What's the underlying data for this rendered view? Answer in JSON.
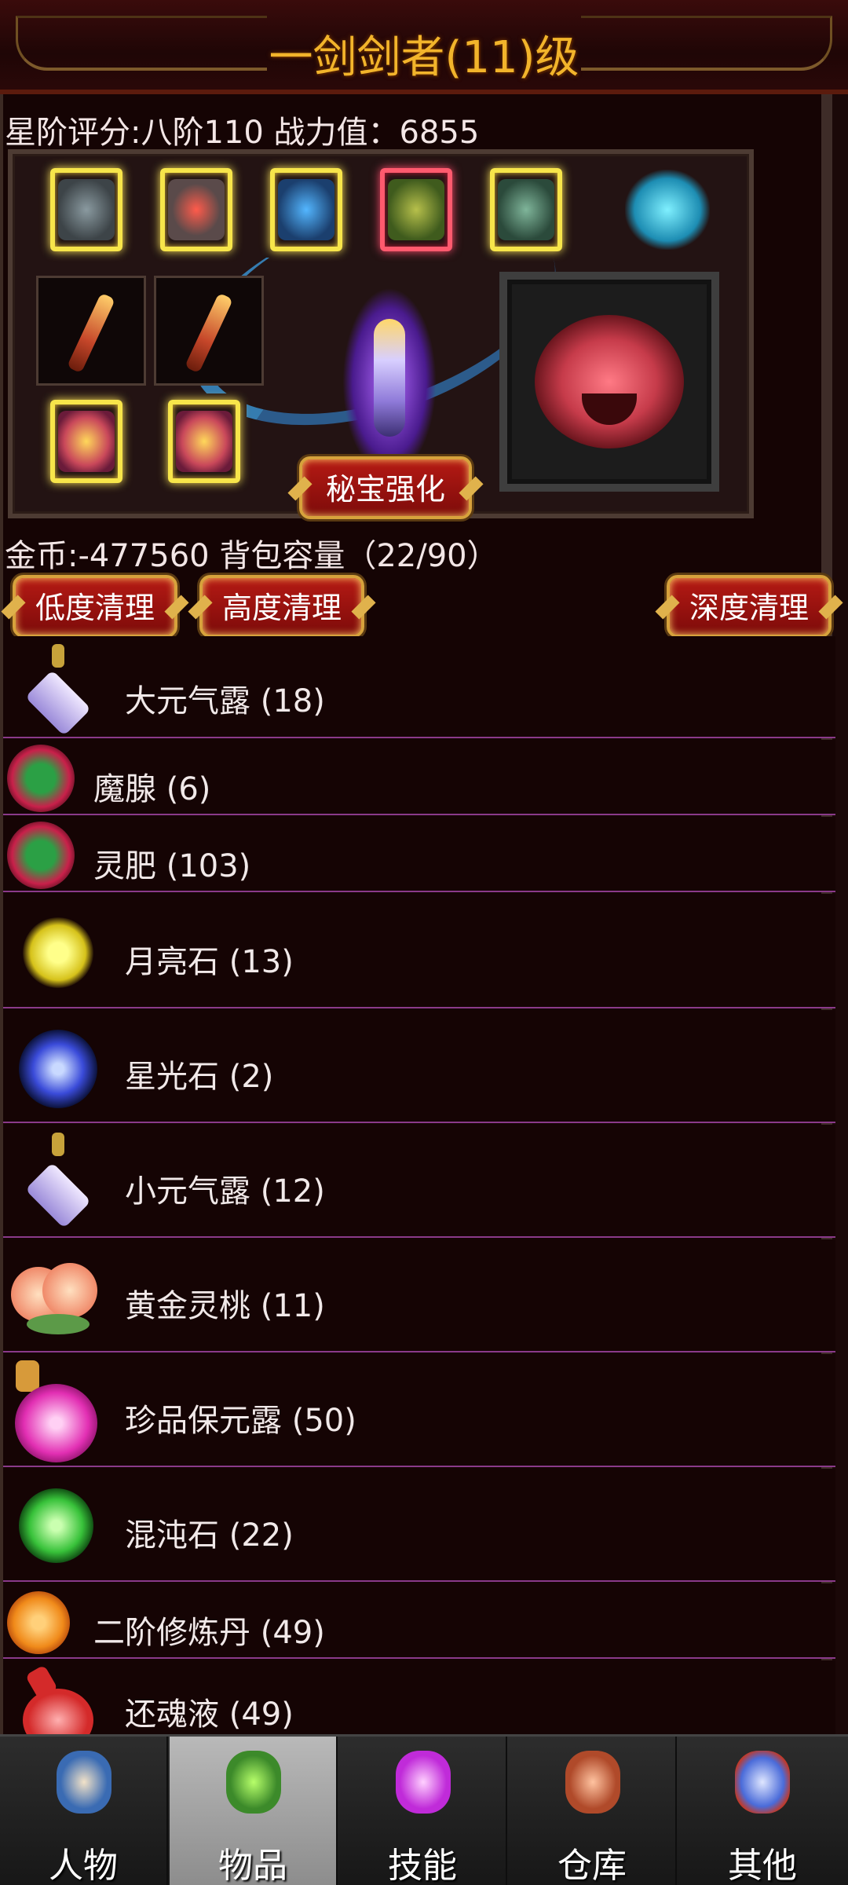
{
  "title": "一剑剑者(11)级",
  "stats": {
    "text": "星阶评分:八阶110 战力值：6855"
  },
  "equipment": {
    "slots": [
      "helmet-icon",
      "armor-icon",
      "cloak-icon",
      "gauntlet-icon",
      "boots-icon",
      "spirit-beast-icon",
      "sword-icon",
      "sword-icon",
      "gem-icon",
      "gem-icon"
    ],
    "pet_icon": "tiger-icon",
    "treasure_button": "秘宝强化"
  },
  "inventory": {
    "coins_capacity": "金币:-477560 背包容量（22/90）"
  },
  "cleanup": {
    "low": "低度清理",
    "high": "高度清理",
    "deep": "深度清理"
  },
  "items": [
    {
      "name": "大元气露 (18)",
      "icon": "potion-icon"
    },
    {
      "name": "魔腺 (6)",
      "icon": "orb-icon"
    },
    {
      "name": "灵肥 (103)",
      "icon": "orb-icon"
    },
    {
      "name": "月亮石 (13)",
      "icon": "moonstone-icon"
    },
    {
      "name": "星光石 (2)",
      "icon": "starstone-icon"
    },
    {
      "name": "小元气露 (12)",
      "icon": "potion-icon"
    },
    {
      "name": "黄金灵桃 (11)",
      "icon": "peach-icon"
    },
    {
      "name": "珍品保元露 (50)",
      "icon": "flask-icon"
    },
    {
      "name": "混沌石 (22)",
      "icon": "chaos-stone-icon"
    },
    {
      "name": "二阶修炼丹 (49)",
      "icon": "pill-icon"
    },
    {
      "name": "还魂液 (49)",
      "icon": "flask-icon"
    }
  ],
  "tabs": [
    {
      "label": "人物",
      "icon": "character-icon",
      "active": false
    },
    {
      "label": "物品",
      "icon": "item-icon",
      "active": true
    },
    {
      "label": "技能",
      "icon": "skill-icon",
      "active": false
    },
    {
      "label": "仓库",
      "icon": "warehouse-icon",
      "active": false
    },
    {
      "label": "其他",
      "icon": "other-icon",
      "active": false
    }
  ]
}
